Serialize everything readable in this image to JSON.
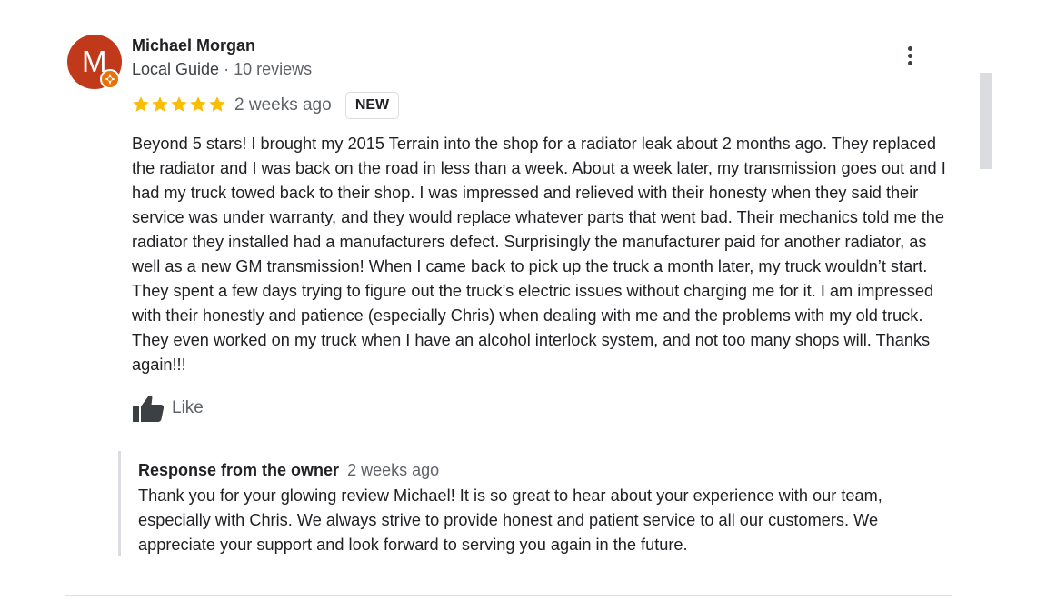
{
  "reviewer": {
    "name": "Michael Morgan",
    "avatar_letter": "M",
    "avatar_color": "#c0391b",
    "guide_label": "Local Guide",
    "separator": " · ",
    "reviews_count": "10 reviews"
  },
  "rating": {
    "stars": 5,
    "max": 5,
    "star_color": "#fbbc04"
  },
  "time_ago": "2 weeks ago",
  "badge": "NEW",
  "review_text": "Beyond 5 stars! I brought my 2015 Terrain into the shop for a radiator leak about 2 months ago. They replaced the radiator and I was back on the road in less than a week. About a week later, my transmission goes out and I had my truck towed back to their shop. I was impressed and relieved with their honesty when they said their service was under warranty, and they would replace whatever parts that went bad. Their mechanics told me the radiator they installed had a manufacturers defect. Surprisingly the manufacturer paid for another radiator, as well as a new GM transmission! When I came back to pick up the truck a month later, my truck wouldn’t start. They spent a few days trying to figure out the truck’s electric issues without charging me for it. I am impressed with their honestly and patience (especially Chris) when dealing with me and the problems with my old truck. They even worked on my truck when I have an alcohol interlock system, and not too many shops will. Thanks again!!!",
  "like_label": "Like",
  "owner_response": {
    "heading": "Response from the owner",
    "time_ago": "2 weeks ago",
    "text": "Thank you for your glowing review Michael! It is so great to hear about your experience with our team, especially with Chris. We always strive to provide honest and patient service to all our customers. We appreciate your support and look forward to serving you again in the future."
  },
  "icons": {
    "more": "more-vert-icon",
    "like": "thumb-up-icon",
    "star": "star-icon",
    "guide": "local-guide-icon"
  }
}
